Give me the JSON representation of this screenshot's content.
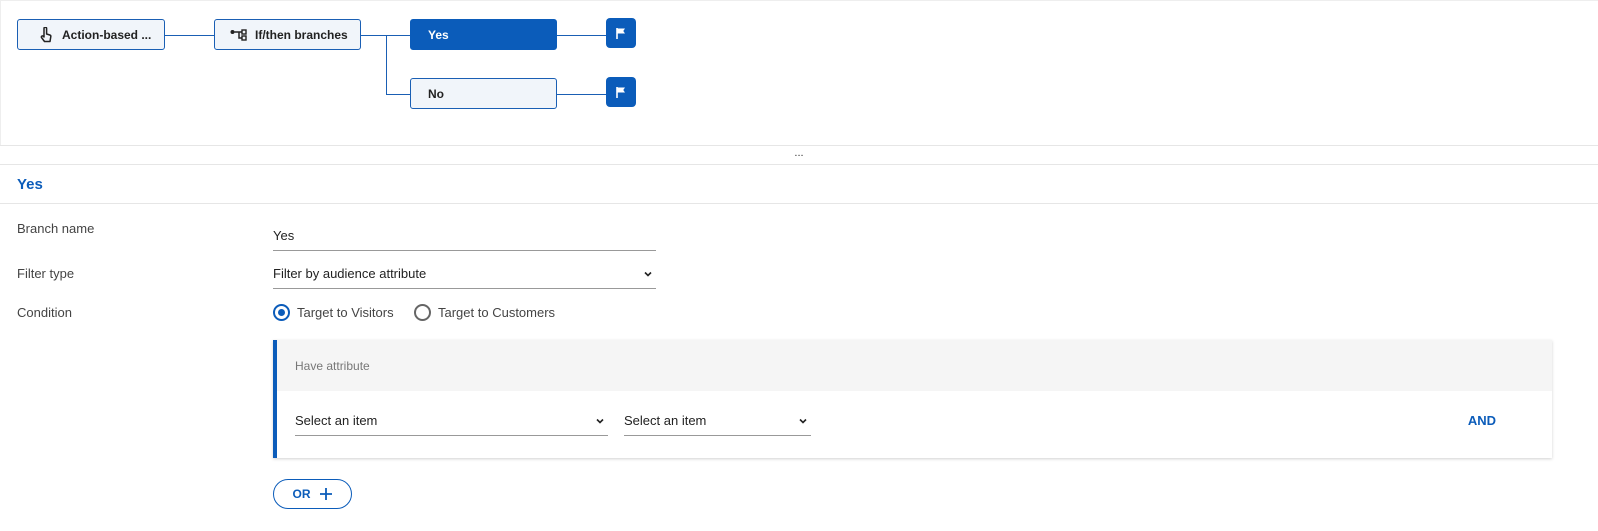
{
  "flow": {
    "nodes": [
      {
        "label": "Action-based ...",
        "icon": "pointer-hand-icon"
      },
      {
        "label": "If/then branches",
        "icon": "branch-icon"
      },
      {
        "label": "Yes",
        "active": true
      },
      {
        "label": "No",
        "active": false
      }
    ],
    "flag_icon": "flag-icon",
    "divider_label": "..."
  },
  "panel": {
    "title": "Yes",
    "branch_name_label": "Branch name",
    "branch_name_value": "Yes",
    "filter_type_label": "Filter type",
    "filter_type_value": "Filter by audience attribute",
    "condition_label": "Condition",
    "radios": [
      {
        "label": "Target to Visitors",
        "checked": true
      },
      {
        "label": "Target to Customers",
        "checked": false
      }
    ],
    "condition_card": {
      "header": "Have attribute",
      "select_1": "Select an item",
      "select_2": "Select an item",
      "and_label": "AND"
    },
    "or_label": "OR"
  },
  "colors": {
    "accent": "#0b5cba",
    "node_bg": "#f1f5fa"
  }
}
